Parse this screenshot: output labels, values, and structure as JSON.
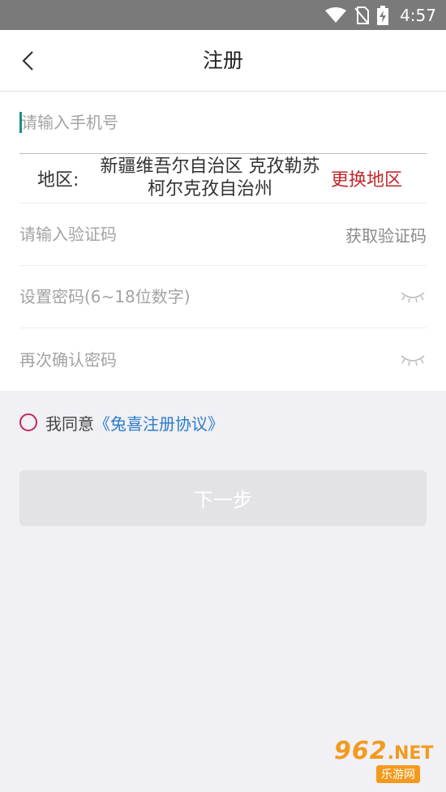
{
  "status_bar": {
    "time": "4:57",
    "icons": [
      "wifi-icon",
      "no-sim-icon",
      "battery-charging-icon"
    ]
  },
  "nav": {
    "title": "注册",
    "back_icon": "chevron-left-icon"
  },
  "form": {
    "phone_placeholder": "请输入手机号",
    "region_label": "地区:",
    "region_name": "新疆维吾尔自治区 克孜勒苏柯尔克孜自治州",
    "change_region": "更换地区",
    "code_placeholder": "请输入验证码",
    "get_code": "获取验证码",
    "password_placeholder": "设置密码(6~18位数字)",
    "confirm_placeholder": "再次确认密码",
    "eye_icon": "eye-closed-icon"
  },
  "agreement": {
    "text": "我同意",
    "link": "《兔喜注册协议》"
  },
  "next_button": "下一步",
  "watermark": {
    "main": "962",
    "net": ".NET",
    "sub": "乐游网"
  },
  "colors": {
    "status_bar": "#7a7a7a",
    "region_change": "#c0282c",
    "link": "#2a7cc7",
    "radio": "#c0285a",
    "button_disabled": "#e3e2e7",
    "background": "#f1f0f5"
  }
}
